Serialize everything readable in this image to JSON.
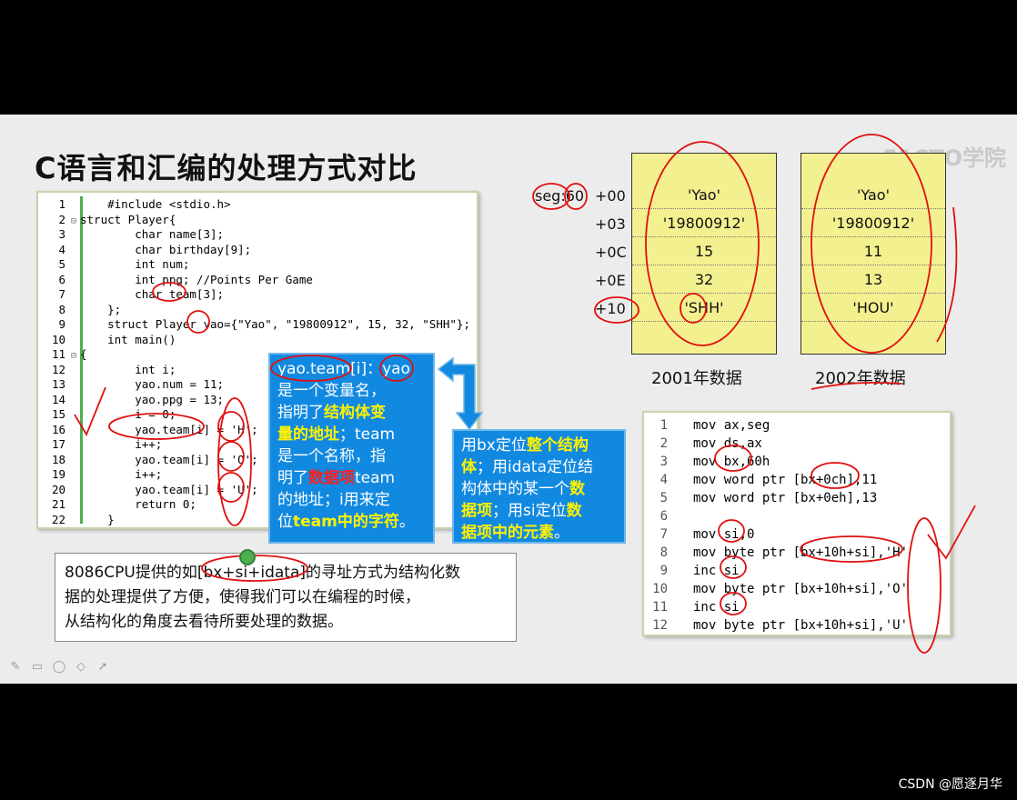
{
  "slide": {
    "title": "C语言和汇编的处理方式对比",
    "watermark": "51CTO学院"
  },
  "c_code": [
    {
      "n": "1",
      "fold": "",
      "text": "    #include <stdio.h>"
    },
    {
      "n": "2",
      "fold": "⊟",
      "text": "struct Player{"
    },
    {
      "n": "3",
      "fold": "",
      "text": "        char name[3];"
    },
    {
      "n": "4",
      "fold": "",
      "text": "        char birthday[9];"
    },
    {
      "n": "5",
      "fold": "",
      "text": "        int num;"
    },
    {
      "n": "6",
      "fold": "",
      "text": "        int ppg; //Points Per Game"
    },
    {
      "n": "7",
      "fold": "",
      "text": "        char team[3];"
    },
    {
      "n": "8",
      "fold": "",
      "text": "    };"
    },
    {
      "n": "9",
      "fold": "",
      "text": "    struct Player yao={\"Yao\", \"19800912\", 15, 32, \"SHH\"};"
    },
    {
      "n": "10",
      "fold": "",
      "text": "    int main()"
    },
    {
      "n": "11",
      "fold": "⊟",
      "text": "{"
    },
    {
      "n": "12",
      "fold": "",
      "text": "        int i;"
    },
    {
      "n": "13",
      "fold": "",
      "text": "        yao.num = 11;"
    },
    {
      "n": "14",
      "fold": "",
      "text": "        yao.ppg = 13;"
    },
    {
      "n": "15",
      "fold": "",
      "text": "        i = 0;"
    },
    {
      "n": "16",
      "fold": "",
      "text": "        yao.team[i] = 'H';"
    },
    {
      "n": "17",
      "fold": "",
      "text": "        i++;"
    },
    {
      "n": "18",
      "fold": "",
      "text": "        yao.team[i] = 'O';"
    },
    {
      "n": "19",
      "fold": "",
      "text": "        i++;"
    },
    {
      "n": "20",
      "fold": "",
      "text": "        yao.team[i] = 'U';"
    },
    {
      "n": "21",
      "fold": "",
      "text": "        return 0;"
    },
    {
      "n": "22",
      "fold": "",
      "text": "    }"
    }
  ],
  "callout_left": {
    "p1": "yao.team[i]：yao",
    "p2": "是一个变量名，",
    "p3": "指明了",
    "p3_hl": "结构体变",
    "p4_hl": "量的地址",
    "p4": "；team",
    "p5": "是一个名称，指",
    "p6": "明了",
    "p6_hl": "数据项",
    "p6b": "team",
    "p7": "的地址；i用来定",
    "p8": "位",
    "p8_hl": "team中的字符",
    "p8b": "。"
  },
  "callout_right": {
    "p1": "用bx定位",
    "p1_hl": "整个结构",
    "p2_hl": "体",
    "p2": "；用idata定位结",
    "p3": "构体中的某一个",
    "p3_hl": "数",
    "p4_hl": "据项",
    "p4": "；用si定位",
    "p4_hl2": "数",
    "p5_hl": "据项中的元素",
    "p5": "。"
  },
  "note": {
    "line1": "8086CPU提供的如[bx+si+idata]的寻址方式为结构化数",
    "line2": "据的处理提供了方便，使得我们可以在编程的时候，",
    "line3": "从结构化的角度去看待所要处理的数据。"
  },
  "memory": {
    "seg_label": "seg:60",
    "offsets": [
      "+00",
      "+03",
      "+0C",
      "+0E",
      "+10"
    ],
    "table_2001": [
      "'Yao'",
      "'19800912'",
      "15",
      "32",
      "'SHH'"
    ],
    "table_2002": [
      "'Yao'",
      "'19800912'",
      "11",
      "13",
      "'HOU'"
    ],
    "caption_2001": "2001年数据",
    "caption_2002": "2002年数据"
  },
  "asm_code": [
    {
      "n": "1",
      "text": "mov ax,seg"
    },
    {
      "n": "2",
      "text": "mov ds,ax"
    },
    {
      "n": "3",
      "text": "mov bx,60h"
    },
    {
      "n": "4",
      "text": "mov word ptr [bx+0ch],11"
    },
    {
      "n": "5",
      "text": "mov word ptr [bx+0eh],13"
    },
    {
      "n": "6",
      "text": ""
    },
    {
      "n": "7",
      "text": "mov si,0"
    },
    {
      "n": "8",
      "text": "mov byte ptr [bx+10h+si],'H'"
    },
    {
      "n": "9",
      "text": "inc si"
    },
    {
      "n": "10",
      "text": "mov byte ptr [bx+10h+si],'O'"
    },
    {
      "n": "11",
      "text": "inc si"
    },
    {
      "n": "12",
      "text": "mov byte ptr [bx+10h+si],'U'"
    }
  ],
  "footer": {
    "csdn": "CSDN @愿逐月华"
  }
}
